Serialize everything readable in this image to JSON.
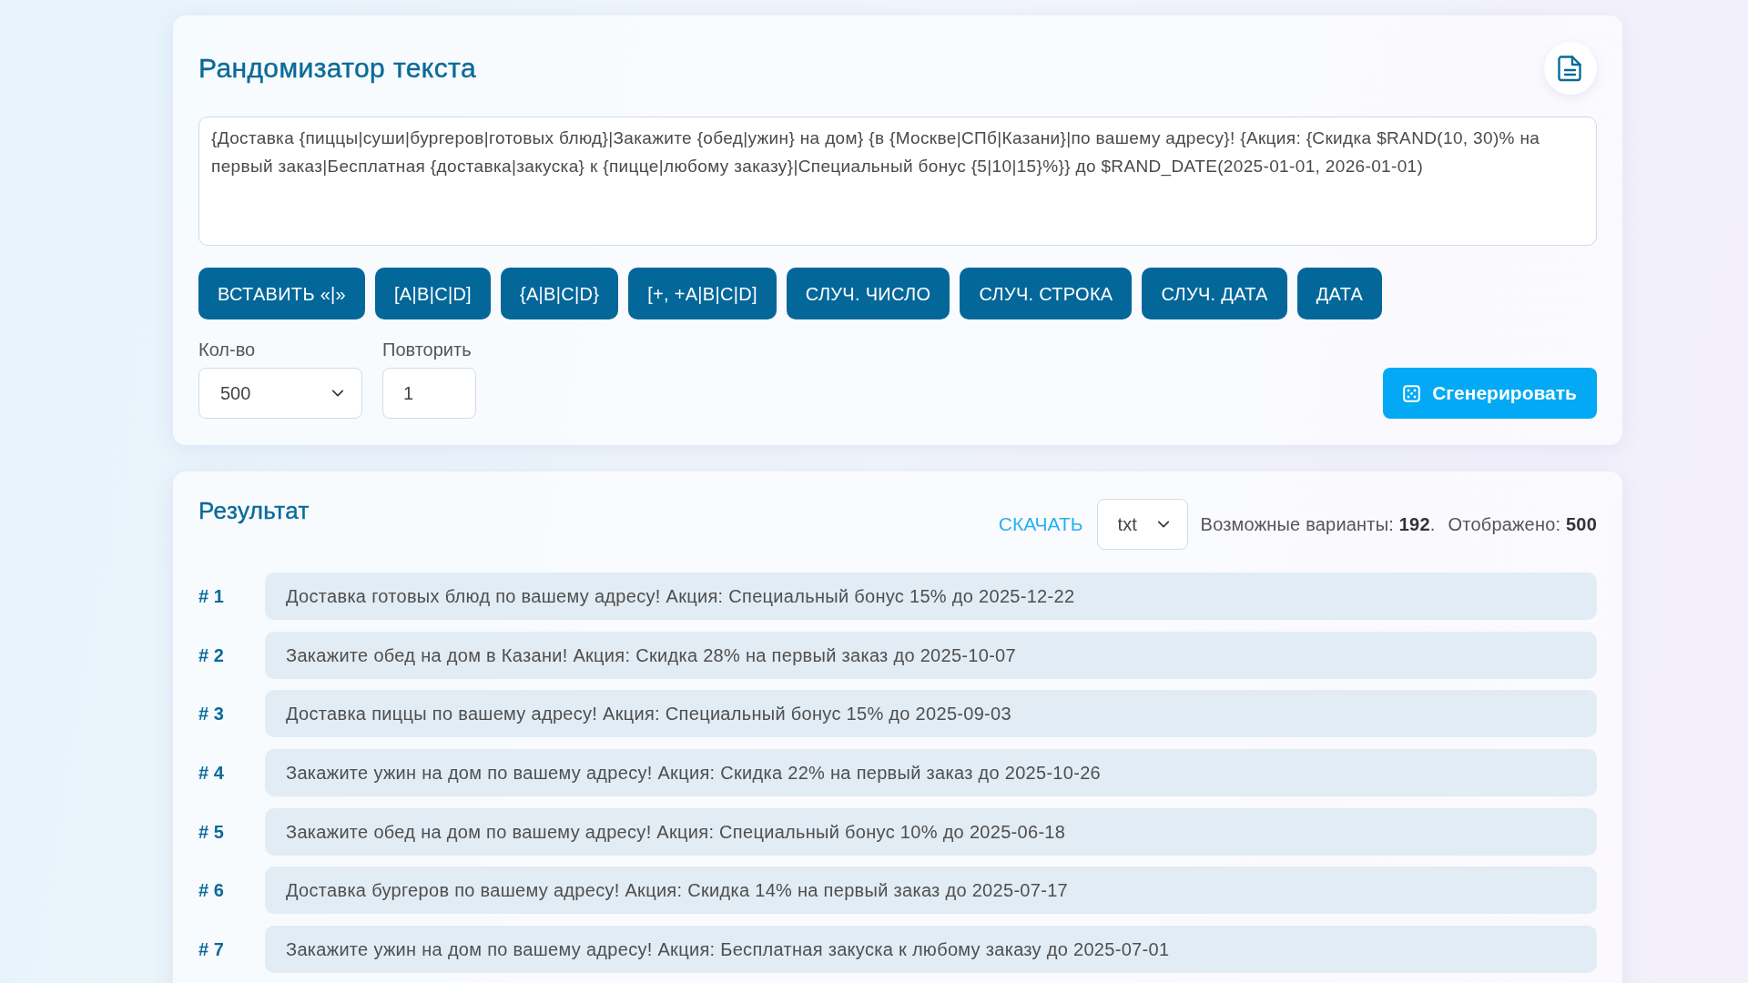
{
  "header": {
    "title": "Рандомизатор текста"
  },
  "template": {
    "value": "{Доставка {пиццы|суши|бургеров|готовых блюд}|Закажите {обед|ужин} на дом} {в {Москве|СПб|Казани}|по вашему адресу}! {Акция: {Скидка $RAND(10, 30)% на первый заказ|Бесплатная {доставка|закуска} к {пицце|любому заказу}|Специальный бонус {5|10|15}%}} до $RAND_DATE(2025-01-01, 2026-01-01)"
  },
  "insert_buttons": [
    "ВСТАВИТЬ «|»",
    "[A|B|C|D]",
    "{A|B|C|D}",
    "[+, +A|B|C|D]",
    "СЛУЧ. ЧИСЛО",
    "СЛУЧ. СТРОКА",
    "СЛУЧ. ДАТА",
    "ДАТА"
  ],
  "count": {
    "label": "Кол-во",
    "value": "500"
  },
  "repeat": {
    "label": "Повторить",
    "value": "1"
  },
  "generate_button": {
    "label": "Сгенерировать"
  },
  "result": {
    "title": "Результат",
    "download_link": "СКАЧАТЬ",
    "format": {
      "value": "txt"
    },
    "stats": [
      "Возможные варианты: **192**.",
      "Отображено: **500**"
    ],
    "rows": [
      {
        "number": "# 1",
        "text": "Доставка готовых блюд по вашему адресу! Акция: Специальный бонус 15% до 2025-12-22"
      },
      {
        "number": "# 2",
        "text": "Закажите обед на дом в Казани! Акция: Скидка 28% на первый заказ до 2025-10-07"
      },
      {
        "number": "# 3",
        "text": "Доставка пиццы по вашему адресу! Акция: Специальный бонус 15% до 2025-09-03"
      },
      {
        "number": "# 4",
        "text": "Закажите ужин на дом по вашему адресу! Акция: Скидка 22% на первый заказ до 2025-10-26"
      },
      {
        "number": "# 5",
        "text": "Закажите обед на дом по вашему адресу! Акция: Специальный бонус 10% до 2025-06-18"
      },
      {
        "number": "# 6",
        "text": "Доставка бургеров по вашему адресу! Акция: Скидка 14% на первый заказ до 2025-07-17"
      },
      {
        "number": "# 7",
        "text": "Закажите ужин на дом по вашему адресу! Акция: Бесплатная закуска к любому заказу до 2025-07-01"
      }
    ]
  }
}
